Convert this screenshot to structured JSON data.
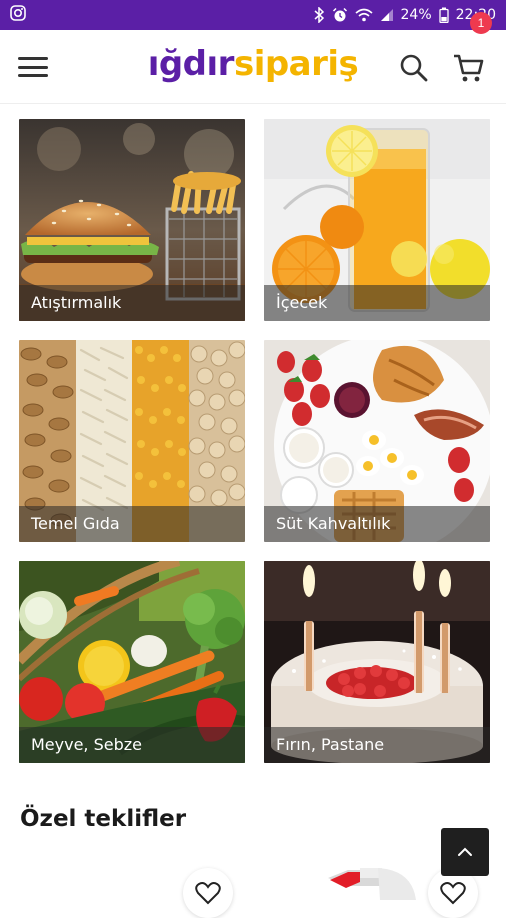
{
  "status_bar": {
    "battery": "24%",
    "time": "22:20",
    "left_icon": "instagram-icon",
    "right_icons": [
      "bluetooth-icon",
      "alarm-icon",
      "wifi-icon",
      "signal-icon",
      "battery-icon"
    ]
  },
  "header": {
    "logo_part1": "ığdır",
    "logo_part2": "sipariş",
    "cart_count": "1",
    "icons": [
      "menu-icon",
      "search-icon",
      "cart-icon"
    ],
    "colors": {
      "brand_purple": "#5b1fa6",
      "brand_yellow": "#f4b400",
      "badge_red": "#ee3a4f"
    }
  },
  "categories": [
    {
      "label": "Atıştırmalık",
      "icon": "burger-fries-photo"
    },
    {
      "label": "İçecek",
      "icon": "orange-juice-photo"
    },
    {
      "label": "Temel Gıda",
      "icon": "grains-legumes-photo"
    },
    {
      "label": "Süt Kahvaltılık",
      "icon": "breakfast-plate-photo"
    },
    {
      "label": "Meyve, Sebze",
      "icon": "vegetables-basket-photo"
    },
    {
      "label": "Fırın, Pastane",
      "icon": "birthday-cake-photo"
    }
  ],
  "offers": {
    "title": "Özel teklifler"
  }
}
